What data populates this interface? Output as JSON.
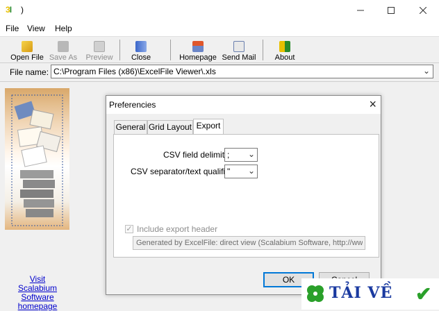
{
  "window": {
    "title": ")",
    "app_icon_text_a": "3",
    "app_icon_text_b": "I"
  },
  "menu": [
    "File",
    "View",
    "Help"
  ],
  "toolbar": {
    "open": "Open File",
    "saveas": "Save As",
    "preview": "Preview",
    "close": "Close",
    "homepage": "Homepage",
    "sendmail": "Send Mail",
    "about": "About"
  },
  "filebar": {
    "label": "File name:",
    "value": "C:\\Program Files (x86)\\ExcelFile Viewer\\.xls"
  },
  "left": {
    "visit_line1": "Visit",
    "visit_line2": "Scalabium Software",
    "visit_line3": "homepage"
  },
  "dialog": {
    "title": "Preferencies",
    "tabs": [
      "General",
      "Grid Layout",
      "Export"
    ],
    "csv_delim_label": "CSV field delimiter:",
    "csv_delim_value": ";",
    "csv_sep_label": "CSV separator/text qualifier:",
    "csv_sep_value": "\"",
    "include_header_label": "Include export header",
    "include_header_checked": true,
    "header_value": "Generated by ExcelFile: direct view (Scalabium Software, http://www.",
    "ok": "OK",
    "cancel": "Cancel"
  },
  "watermark": {
    "text": "TẢI VỀ"
  },
  "colors": {
    "accent": "#0078d7",
    "link": "#0000cc",
    "disabled": "#8d8d8d"
  }
}
